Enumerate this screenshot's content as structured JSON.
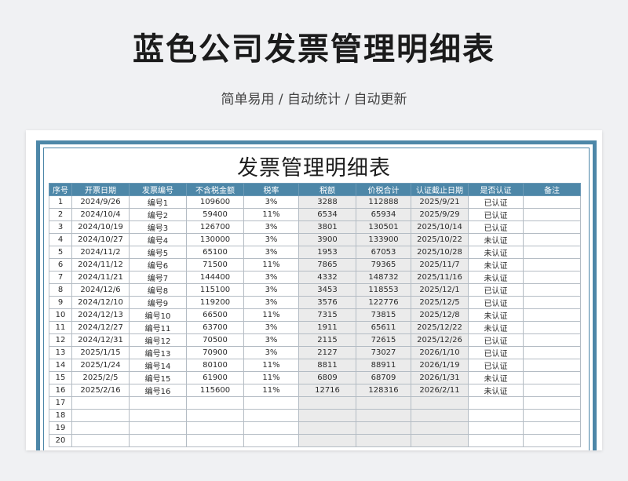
{
  "header": {
    "title": "蓝色公司发票管理明细表",
    "subtitle": "简单易用 / 自动统计 / 自动更新"
  },
  "sheet": {
    "title": "发票管理明细表",
    "columns": [
      "序号",
      "开票日期",
      "发票编号",
      "不含税金额",
      "税率",
      "税额",
      "价税合计",
      "认证截止日期",
      "是否认证",
      "备注"
    ],
    "rows": [
      [
        "1",
        "2024/9/26",
        "编号1",
        "109600",
        "3%",
        "3288",
        "112888",
        "2025/9/21",
        "已认证",
        ""
      ],
      [
        "2",
        "2024/10/4",
        "编号2",
        "59400",
        "11%",
        "6534",
        "65934",
        "2025/9/29",
        "已认证",
        ""
      ],
      [
        "3",
        "2024/10/19",
        "编号3",
        "126700",
        "3%",
        "3801",
        "130501",
        "2025/10/14",
        "已认证",
        ""
      ],
      [
        "4",
        "2024/10/27",
        "编号4",
        "130000",
        "3%",
        "3900",
        "133900",
        "2025/10/22",
        "未认证",
        ""
      ],
      [
        "5",
        "2024/11/2",
        "编号5",
        "65100",
        "3%",
        "1953",
        "67053",
        "2025/10/28",
        "未认证",
        ""
      ],
      [
        "6",
        "2024/11/12",
        "编号6",
        "71500",
        "11%",
        "7865",
        "79365",
        "2025/11/7",
        "未认证",
        ""
      ],
      [
        "7",
        "2024/11/21",
        "编号7",
        "144400",
        "3%",
        "4332",
        "148732",
        "2025/11/16",
        "未认证",
        ""
      ],
      [
        "8",
        "2024/12/6",
        "编号8",
        "115100",
        "3%",
        "3453",
        "118553",
        "2025/12/1",
        "已认证",
        ""
      ],
      [
        "9",
        "2024/12/10",
        "编号9",
        "119200",
        "3%",
        "3576",
        "122776",
        "2025/12/5",
        "已认证",
        ""
      ],
      [
        "10",
        "2024/12/13",
        "编号10",
        "66500",
        "11%",
        "7315",
        "73815",
        "2025/12/8",
        "未认证",
        ""
      ],
      [
        "11",
        "2024/12/27",
        "编号11",
        "63700",
        "3%",
        "1911",
        "65611",
        "2025/12/22",
        "未认证",
        ""
      ],
      [
        "12",
        "2024/12/31",
        "编号12",
        "70500",
        "3%",
        "2115",
        "72615",
        "2025/12/26",
        "已认证",
        ""
      ],
      [
        "13",
        "2025/1/15",
        "编号13",
        "70900",
        "3%",
        "2127",
        "73027",
        "2026/1/10",
        "已认证",
        ""
      ],
      [
        "14",
        "2025/1/24",
        "编号14",
        "80100",
        "11%",
        "8811",
        "88911",
        "2026/1/19",
        "已认证",
        ""
      ],
      [
        "15",
        "2025/2/5",
        "编号15",
        "61900",
        "11%",
        "6809",
        "68709",
        "2026/1/31",
        "未认证",
        ""
      ],
      [
        "16",
        "2025/2/16",
        "编号16",
        "115600",
        "11%",
        "12716",
        "128316",
        "2026/2/11",
        "未认证",
        ""
      ],
      [
        "17",
        "",
        "",
        "",
        "",
        "",
        "",
        "",
        "",
        ""
      ],
      [
        "18",
        "",
        "",
        "",
        "",
        "",
        "",
        "",
        "",
        ""
      ],
      [
        "19",
        "",
        "",
        "",
        "",
        "",
        "",
        "",
        "",
        ""
      ],
      [
        "20",
        "",
        "",
        "",
        "",
        "",
        "",
        "",
        "",
        ""
      ]
    ]
  },
  "colors": {
    "accent": "#4d87a8",
    "shaded_column": "#ebebeb"
  }
}
